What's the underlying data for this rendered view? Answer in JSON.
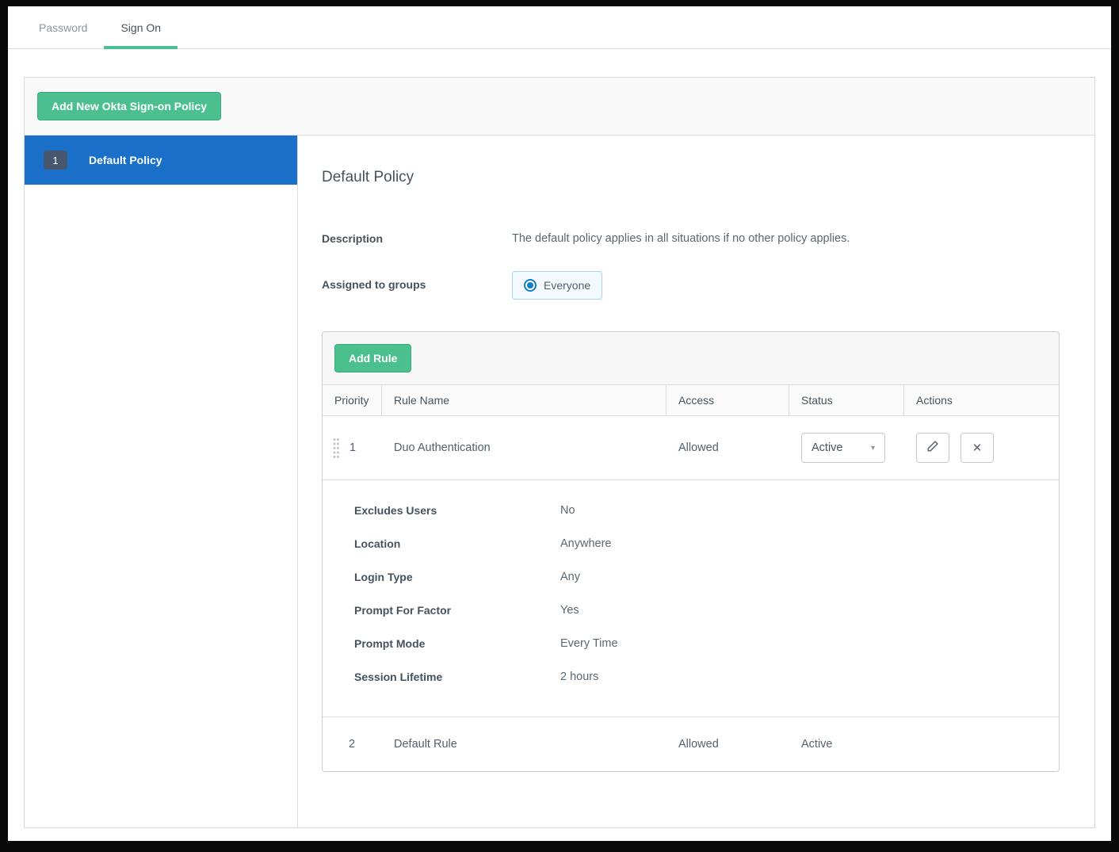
{
  "tabs": [
    {
      "label": "Password"
    },
    {
      "label": "Sign On"
    }
  ],
  "panel": {
    "add_policy_button": "Add New Okta Sign-on Policy",
    "sidebar": {
      "items": [
        {
          "priority": "1",
          "label": "Default Policy"
        }
      ]
    },
    "detail": {
      "title": "Default Policy",
      "fields": {
        "description_label": "Description",
        "description_value": "The default policy applies in all situations if no other policy applies.",
        "assigned_label": "Assigned to groups",
        "assigned_value": "Everyone"
      },
      "rules": {
        "add_rule_button": "Add Rule",
        "columns": [
          "Priority",
          "Rule Name",
          "Access",
          "Status",
          "Actions"
        ],
        "rows": [
          {
            "priority": "1",
            "name": "Duo Authentication",
            "access": "Allowed",
            "status": "Active",
            "details": [
              {
                "label": "Excludes Users",
                "value": "No"
              },
              {
                "label": "Location",
                "value": "Anywhere"
              },
              {
                "label": "Login Type",
                "value": "Any"
              },
              {
                "label": "Prompt For Factor",
                "value": "Yes"
              },
              {
                "label": "Prompt Mode",
                "value": "Every Time"
              },
              {
                "label": "Session Lifetime",
                "value": "2 hours"
              }
            ]
          },
          {
            "priority": "2",
            "name": "Default Rule",
            "access": "Allowed",
            "status": "Active"
          }
        ]
      }
    }
  },
  "colors": {
    "accent_green": "#4cbf8f",
    "selected_blue": "#1a6fc9",
    "radio_blue": "#0f7dc2",
    "badge_slate": "#47586e"
  }
}
